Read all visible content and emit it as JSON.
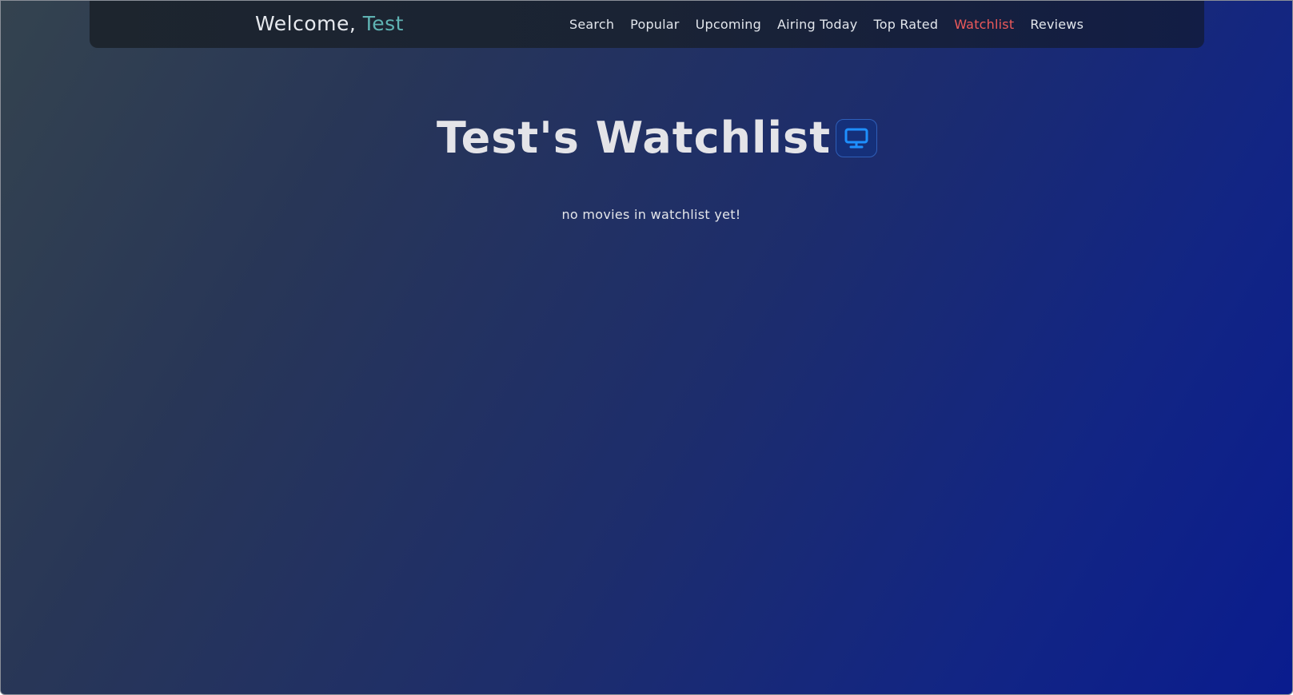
{
  "header": {
    "welcome_prefix": "Welcome, ",
    "username": "Test"
  },
  "nav": {
    "items": [
      {
        "label": "Search",
        "active": false
      },
      {
        "label": "Popular",
        "active": false
      },
      {
        "label": "Upcoming",
        "active": false
      },
      {
        "label": "Airing Today",
        "active": false
      },
      {
        "label": "Top Rated",
        "active": false
      },
      {
        "label": "Watchlist",
        "active": true
      },
      {
        "label": "Reviews",
        "active": false
      }
    ]
  },
  "main": {
    "title": "Test's Watchlist",
    "title_icon": "monitor-icon",
    "empty_message": "no movies in watchlist yet!"
  },
  "colors": {
    "accent_username": "#5fb3b3",
    "active_nav": "#ee5a5a",
    "icon_blue": "#1e90ff"
  }
}
